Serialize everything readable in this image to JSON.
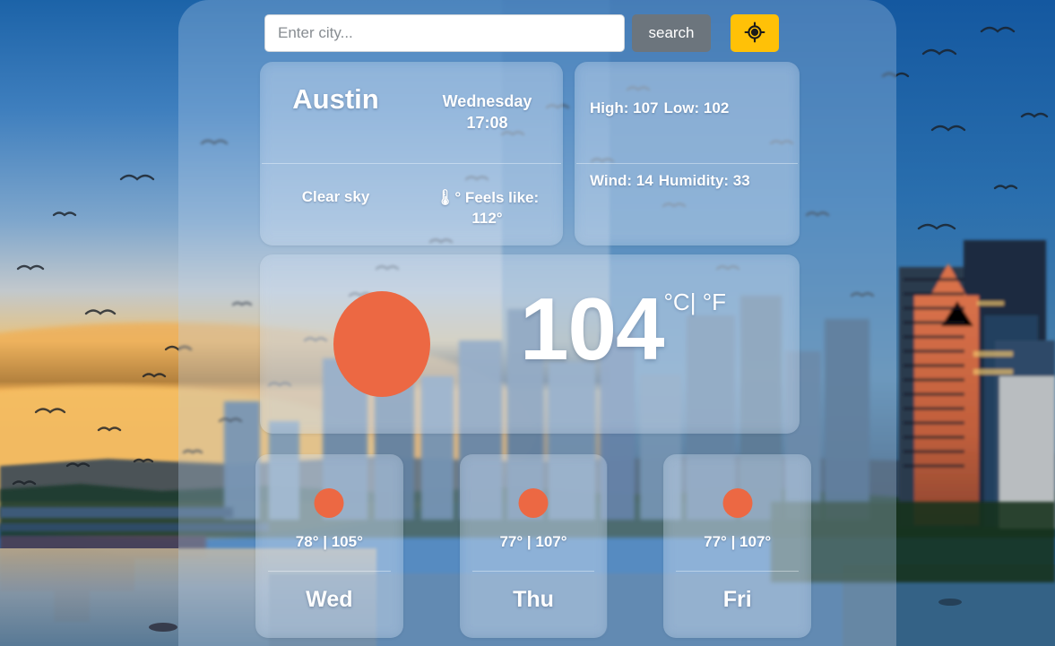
{
  "search": {
    "placeholder": "Enter city...",
    "value": "",
    "search_label": "search",
    "geo_icon": "crosshair-location-icon",
    "geo_color": "#ffc107",
    "search_button_color": "#6c757d"
  },
  "current": {
    "city": "Austin",
    "day": "Wednesday",
    "time": "17:08",
    "condition": "Clear sky",
    "feels_like": "🌡° Feels like: 112°",
    "temperature": "104",
    "unit_celsius": "°C",
    "unit_separator": "|",
    "unit_fahrenheit": "°F",
    "weather_icon": "sun-icon",
    "icon_color": "#ec6843"
  },
  "stats": {
    "high": "High: 107",
    "low": "Low: 102",
    "wind": "Wind: 14",
    "humidity": "Humidity: 33"
  },
  "forecast": [
    {
      "day": "Wed",
      "temps": "78° | 105°",
      "icon": "sun-icon"
    },
    {
      "day": "Thu",
      "temps": "77° | 107°",
      "icon": "sun-icon"
    },
    {
      "day": "Fri",
      "temps": "77° | 107°",
      "icon": "sun-icon"
    }
  ]
}
